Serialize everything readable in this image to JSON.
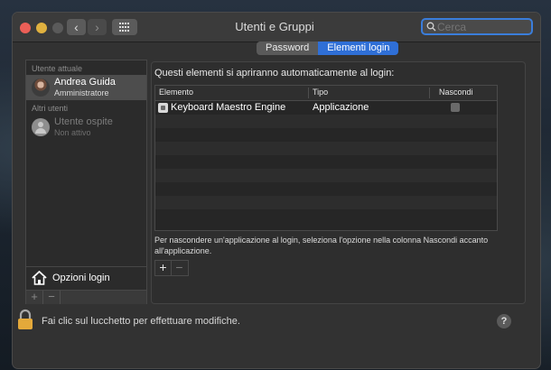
{
  "window": {
    "title": "Utenti e Gruppi",
    "search_placeholder": "Cerca"
  },
  "sidebar": {
    "current_user_header": "Utente attuale",
    "other_users_header": "Altri utenti",
    "users": [
      {
        "name": "Andrea Guida",
        "role": "Amministratore",
        "selected": true,
        "enabled": true
      },
      {
        "name": "Utente ospite",
        "role": "Non attivo",
        "selected": false,
        "enabled": false
      }
    ],
    "login_options_label": "Opzioni login",
    "add_label": "+",
    "remove_label": "−"
  },
  "tabs": [
    {
      "label": "Password",
      "active": false
    },
    {
      "label": "Elementi login",
      "active": true
    }
  ],
  "login_items": {
    "intro": "Questi elementi si apriranno automaticamente al login:",
    "columns": [
      "Elemento",
      "Tipo",
      "Nascondi"
    ],
    "rows": [
      {
        "item": "Keyboard Maestro Engine",
        "type": "Applicazione",
        "hide": false
      }
    ],
    "hint": "Per nascondere un'applicazione al login, seleziona l'opzione nella colonna Nascondi accanto all'applicazione.",
    "add_label": "+",
    "remove_label": "−"
  },
  "footer": {
    "lock_text": "Fai clic sul lucchetto per effettuare modifiche.",
    "help_label": "?"
  },
  "colors": {
    "accent": "#2f6fd6",
    "close": "#ec5f57",
    "minimize": "#e0b13f",
    "lock": "#e4a93a"
  }
}
